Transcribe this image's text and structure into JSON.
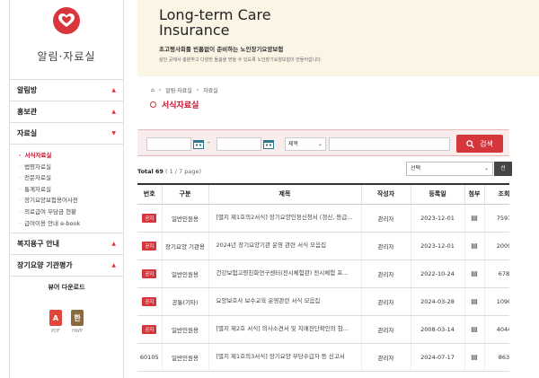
{
  "sidebar": {
    "title": "알림·자료실",
    "menus": [
      {
        "label": "알림방"
      },
      {
        "label": "홍보관"
      },
      {
        "label": "자료실"
      }
    ],
    "sub_items": [
      {
        "label": "서식자료실"
      },
      {
        "label": "법령자료실"
      },
      {
        "label": "전문자료실"
      },
      {
        "label": "통계자료실"
      },
      {
        "label": "장기요양보험용어사전"
      },
      {
        "label": "의료급여 부담금 현황"
      },
      {
        "label": "급여이용 안내 e-book"
      }
    ],
    "menus_after": [
      {
        "label": "복지용구 안내"
      },
      {
        "label": "장기요양 기관평가"
      }
    ],
    "download_label": "뷰어 다운로드",
    "files": [
      {
        "label": "PDF",
        "glyph": "A",
        "color": "#e0473a"
      },
      {
        "label": "HWP",
        "glyph": "한",
        "color": "#8a6a3e"
      }
    ]
  },
  "banner": {
    "title_line1": "Long-term Care",
    "title_line2": "Insurance",
    "subtitle": "초고령사회를 빈틈없이 준비하는 노인장기요양보험",
    "description": "살던 곳에서 충분하고 다양한 돌봄을 받을 수 있도록 노인장기요양보험이 만들어갑니다."
  },
  "breadcrumb": [
    "⌂",
    "알림·자료실",
    "자료실"
  ],
  "page_title": "서식자료실",
  "search": {
    "date_separator": "-",
    "field_select": "제목",
    "button_label": "검색"
  },
  "list": {
    "total_label": "Total",
    "total": "69",
    "page_info": "( 1 / 7 page)",
    "sort_select": "선택",
    "sort_button": "선"
  },
  "table": {
    "headers": [
      "번호",
      "구분",
      "제목",
      "작성자",
      "등록일",
      "첨부",
      "조회"
    ],
    "rows": [
      {
        "no": "공지",
        "category": "일반민원용",
        "title": "[별지 제1호의2서식] 장기요양인정신청서 (갱신, 등급...",
        "author": "관리자",
        "date": "2023-12-01",
        "views": "7597"
      },
      {
        "no": "공지",
        "category": "장기요양 기관용",
        "title": "2024년 장기요양기관 운영 관련 서식 모음집",
        "author": "관리자",
        "date": "2023-12-01",
        "views": "2009"
      },
      {
        "no": "공지",
        "category": "일반민원용",
        "title": "건강보험고령친화연구센터(전시체험관) 전시체험 프...",
        "author": "관리자",
        "date": "2022-10-24",
        "views": "678"
      },
      {
        "no": "공지",
        "category": "공통(기타)",
        "title": "요양보호사 보수교육 운영관련 서식 모음집",
        "author": "관리자",
        "date": "2024-03-28",
        "views": "1090"
      },
      {
        "no": "공지",
        "category": "일반민원용",
        "title": "[별지 제2호 서식] 의사소견서 및 치매진단확인의 참...",
        "author": "관리자",
        "date": "2008-03-14",
        "views": "4044"
      },
      {
        "no": "60105",
        "category": "일반민원용",
        "title": "[별지 제1호의3서식] 장기요양 부당수급자 등 신고서",
        "author": "관리자",
        "date": "2024-07-17",
        "views": "863"
      }
    ]
  },
  "colors": {
    "accent": "#d4363c",
    "banner_bg": "#fbf5e6",
    "search_bg": "#f9ecec"
  }
}
